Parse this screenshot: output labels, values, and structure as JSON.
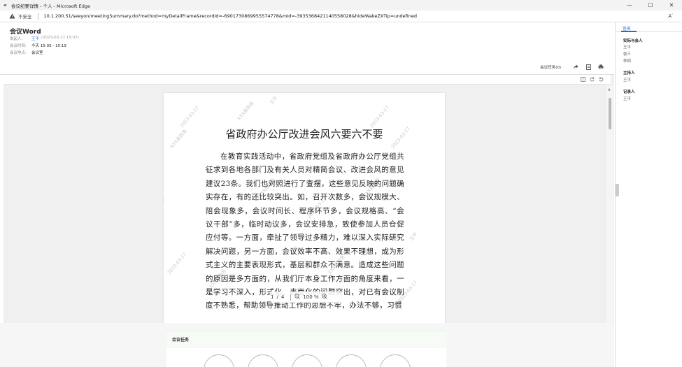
{
  "window": {
    "title": "会议纪要详情 - 个人 - Microsoft Edge",
    "minimize": "—",
    "maximize": "☐",
    "close": "✕"
  },
  "addressbar": {
    "insecure_label": "不安全",
    "url": "10.1.200.51/seeyon/meetingSummary.do?method=myDetailFrame&recordId=-6901730869955574778&mId=-3935368421140558028&hideWakeZXTip=undefined",
    "read_aloud": "Aʹ"
  },
  "header": {
    "title": "会议Word",
    "initiator_label": "发起人:",
    "initiator": "王平",
    "initiator_time": "(2023-03-17 15:07)",
    "meeting_time_label": "会议时间:",
    "meeting_time": "今天 15:05 - 15:19",
    "location_label": "会议地点:",
    "location": "会议室",
    "tasks_link": "会议任务(0)"
  },
  "document": {
    "heading": "省政府办公厅改进会风六要六不要",
    "body": "在教育实践活动中，省政府党组及省政府办公厅党组共征求到各地各部门及有关人员对精简会议、改进会风的意见建议23条。我们也对照进行了查摆，这些意见反映的问题确实存在，有的还比较突出。如，召开次数多，会议规模大、陪会现象多，会议时间长、程序环节多，会议规格高、“会议干部”多，临时动议多，会议安排急，致使参加人员仓促应付等。一方面，牵扯了领导过多精力，难以深入实际研究解决问题，另一方面，会议效率不高、效果不理想，成为形式主义的主要表现形式，基层和群众不满意。造成这些问题的原因是多方面的，从我们厅本身工作方面的角度来看，一是学习不深入，形式化、表面化的问题突出，对已有会议制度不熟悉，帮助领导推动工作的思想不牢，办法不够，习惯",
    "watermark_name": "王平",
    "watermark_org": "XXX县政务",
    "watermark_date": "2023-03-17"
  },
  "page_nav": {
    "current": "1",
    "slash": "/",
    "total": "4",
    "zoom": "100 %"
  },
  "right_panel": {
    "tab": "签名",
    "attendees_title": "实际与会人",
    "attendees": [
      "王平",
      "张三",
      "李四"
    ],
    "host_title": "主持人",
    "host": "王平",
    "recorder_title": "记录人",
    "recorder": "王平"
  },
  "tasks": {
    "title": "会议任务"
  },
  "colors": {
    "accent": "#2a6dc6",
    "task_header_bg": "#f7fbf5"
  }
}
